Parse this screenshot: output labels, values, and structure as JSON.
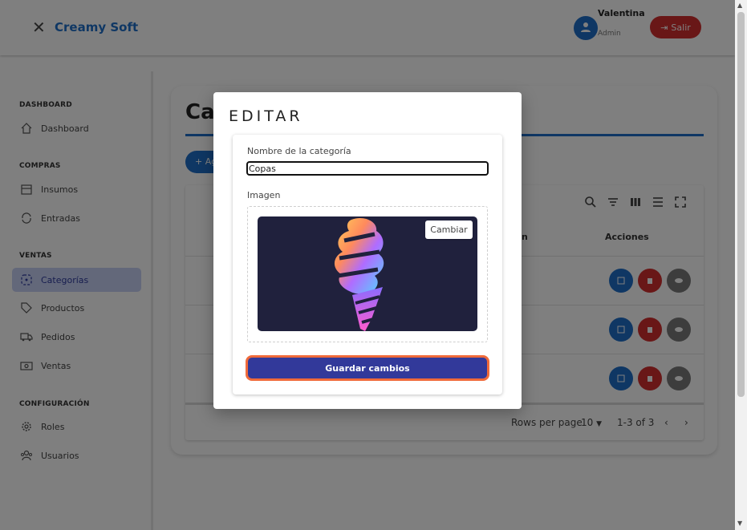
{
  "header": {
    "close_icon": "close-icon",
    "brand": "Creamy Soft",
    "user_name": "Valentina",
    "user_role": "Admin",
    "logout_label": "Salir"
  },
  "sidebar": {
    "sections": [
      {
        "title": "DASHBOARD",
        "items": [
          {
            "label": "Dashboard",
            "icon": "home-icon"
          }
        ]
      },
      {
        "title": "COMPRAS",
        "items": [
          {
            "label": "Insumos",
            "icon": "store-icon"
          },
          {
            "label": "Entradas",
            "icon": "refresh-icon"
          }
        ]
      },
      {
        "title": "VENTAS",
        "items": [
          {
            "label": "Categorías",
            "icon": "category-icon",
            "active": true
          },
          {
            "label": "Productos",
            "icon": "tag-icon"
          },
          {
            "label": "Pedidos",
            "icon": "truck-icon"
          },
          {
            "label": "Ventas",
            "icon": "cash-icon"
          }
        ]
      },
      {
        "title": "CONFIGURACIÓN",
        "items": [
          {
            "label": "Roles",
            "icon": "gear-icon"
          },
          {
            "label": "Usuarios",
            "icon": "users-icon"
          }
        ]
      }
    ]
  },
  "page": {
    "title_partial": "Ca",
    "add_button_partial": "+ Ag",
    "columns": {
      "actions": "Acciones",
      "status_partial": "n"
    },
    "pagination": {
      "rows_per_page_label": "Rows per page",
      "rows_per_page_value": "10",
      "range": "1-3 of 3"
    }
  },
  "modal": {
    "title": "EDITAR",
    "name_label": "Nombre de la categoría",
    "name_value": "Copas",
    "image_label": "Imagen",
    "change_label": "Cambiar",
    "save_label": "Guardar cambios"
  },
  "colors": {
    "brand_blue": "#1e6fc8",
    "danger_red": "#d32f2f",
    "save_button": "#32399a",
    "save_border": "#f06a3a",
    "active_nav": "#c6d1f5"
  }
}
